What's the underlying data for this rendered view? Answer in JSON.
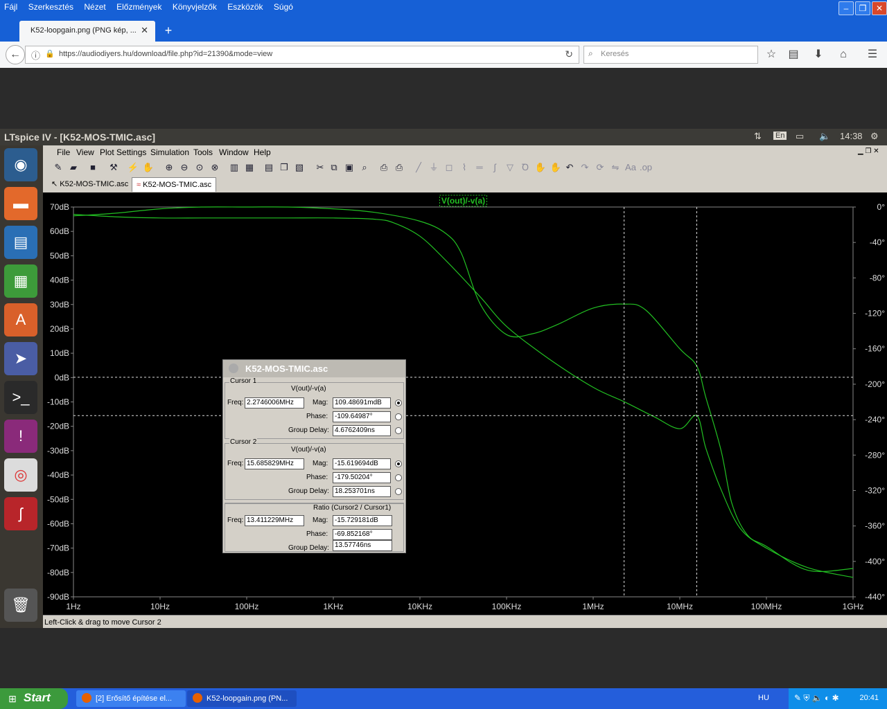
{
  "firefox": {
    "menu": [
      "Fájl",
      "Szerkesztés",
      "Nézet",
      "Előzmények",
      "Könyvjelzők",
      "Eszközök",
      "Súgó"
    ],
    "tab_title": "K52-loopgain.png (PNG kép, ...",
    "url": "https://audiodiyers.hu/download/file.php?id=21390&mode=view",
    "search_placeholder": "Keresés"
  },
  "ubuntu_panel": {
    "window_title": "LTspice IV - [K52-MOS-TMIC.asc]",
    "lang": "En",
    "time": "14:38"
  },
  "ltspice": {
    "menu": [
      "File",
      "View",
      "Plot Settings",
      "Simulation",
      "Tools",
      "Window",
      "Help"
    ],
    "tabs": [
      "K52-MOS-TMIC.asc",
      "K52-MOS-TMIC.asc"
    ],
    "status": "Left-Click & drag to move Cursor 2"
  },
  "chart_data": {
    "type": "line",
    "title": "V(out)/-v(a)",
    "x_scale": "log",
    "xlim_hz": [
      1,
      1000000000
    ],
    "x_ticks": [
      "1Hz",
      "10Hz",
      "100Hz",
      "1KHz",
      "10KHz",
      "100KHz",
      "1MHz",
      "10MHz",
      "100MHz",
      "1GHz"
    ],
    "ylim_db": [
      -90,
      70
    ],
    "y_ticks_left": [
      "70dB",
      "60dB",
      "50dB",
      "40dB",
      "30dB",
      "20dB",
      "10dB",
      "0dB",
      "-10dB",
      "-20dB",
      "-30dB",
      "-40dB",
      "-50dB",
      "-60dB",
      "-70dB",
      "-80dB",
      "-90dB"
    ],
    "ylim_deg": [
      -440,
      0
    ],
    "y_ticks_right": [
      "0°",
      "-40°",
      "-80°",
      "-120°",
      "-160°",
      "-200°",
      "-240°",
      "-280°",
      "-320°",
      "-360°",
      "-400°",
      "-440°"
    ],
    "line_color": "#22c022",
    "series": [
      {
        "name": "magnitude",
        "x": [
          1,
          3,
          10,
          30,
          100,
          300,
          1000,
          3000,
          5000,
          10000,
          20000,
          50000,
          100000,
          300000,
          1000000,
          2270000,
          5000000,
          10000000,
          15700000,
          20000000,
          30000000,
          50000000,
          100000000,
          300000000,
          1000000000
        ],
        "y": [
          67,
          66,
          65.5,
          65.5,
          65.5,
          65.5,
          65.5,
          65,
          63.5,
          58,
          48,
          33,
          21,
          8,
          -4,
          -9.9,
          -16,
          -21,
          -15.6,
          -29,
          -46,
          -62,
          -70,
          -78,
          -82
        ]
      },
      {
        "name": "phase",
        "x": [
          1,
          3,
          10,
          30,
          100,
          300,
          1000,
          3000,
          10000,
          20000,
          30000,
          50000,
          100000,
          200000,
          400000,
          1000000,
          2270000,
          4000000,
          10000000,
          15700000,
          20000000,
          30000000,
          40000000,
          60000000,
          100000000,
          300000000,
          1000000000
        ],
        "y": [
          -10,
          -7,
          -2,
          0,
          0,
          0,
          -2,
          -6,
          -16,
          -30,
          -52,
          -110,
          -144,
          -143,
          -132,
          -114,
          -109.6,
          -116,
          -160,
          -179.5,
          -215,
          -275,
          -335,
          -370,
          -383,
          -410,
          -408
        ]
      }
    ],
    "cursors": [
      {
        "name": "Cursor 1",
        "freq_hz": 2274600.6,
        "mag_db": 0.10948691,
        "phase_deg": -109.64987
      },
      {
        "name": "Cursor 2",
        "freq_hz": 15685829,
        "mag_db": -15.619694,
        "phase_deg": -179.50204
      }
    ]
  },
  "cursor_dialog": {
    "title": "K52-MOS-TMIC.asc",
    "cursor1": {
      "label": "Cursor 1",
      "expr": "V(out)/-v(a)",
      "freq": "2.2746006MHz",
      "mag": "109.48691mdB",
      "phase": "-109.64987°",
      "group_delay": "4.6762409ns"
    },
    "cursor2": {
      "label": "Cursor 2",
      "expr": "V(out)/-v(a)",
      "freq": "15.685829MHz",
      "mag": "-15.619694dB",
      "phase": "-179.50204°",
      "group_delay": "18.253701ns"
    },
    "ratio": {
      "label": "Ratio (Cursor2 / Cursor1)",
      "freq": "13.411229MHz",
      "mag": "-15.729181dB",
      "phase": "-69.852168°",
      "group_delay": "13.57746ns"
    },
    "labels": {
      "freq": "Freq:",
      "mag": "Mag:",
      "phase": "Phase:",
      "group_delay": "Group Delay:"
    }
  },
  "taskbar": {
    "start": "Start",
    "tasks": [
      "[2] Erősítő építése el...",
      "K52-loopgain.png (PN..."
    ],
    "lang": "HU",
    "clock": "20:41"
  }
}
